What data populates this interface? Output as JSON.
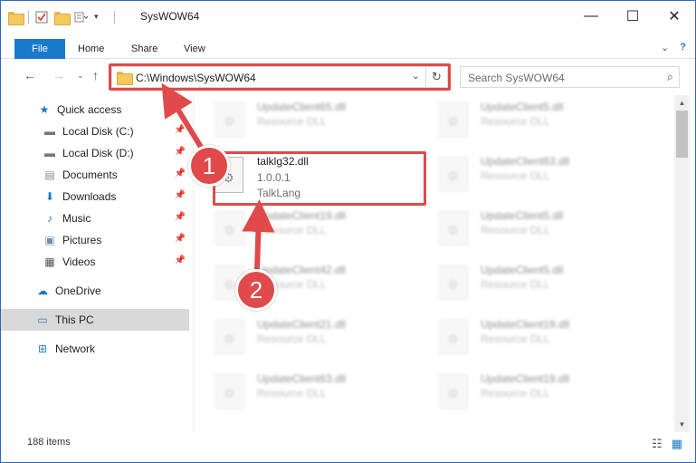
{
  "window": {
    "title": "SysWOW64"
  },
  "ribbon": {
    "tabs": [
      "File",
      "Home",
      "Share",
      "View"
    ]
  },
  "address": {
    "path": "C:\\Windows\\SysWOW64"
  },
  "search": {
    "placeholder": "Search SysWOW64"
  },
  "sidebar": {
    "items": [
      {
        "label": "Quick access",
        "icon": "star-icon",
        "pinned": false
      },
      {
        "label": "Local Disk (C:)",
        "icon": "drive-icon",
        "pinned": true
      },
      {
        "label": "Local Disk (D:)",
        "icon": "drive-icon",
        "pinned": true
      },
      {
        "label": "Documents",
        "icon": "documents-icon",
        "pinned": true
      },
      {
        "label": "Downloads",
        "icon": "download-icon",
        "pinned": true
      },
      {
        "label": "Music",
        "icon": "music-icon",
        "pinned": true
      },
      {
        "label": "Pictures",
        "icon": "pictures-icon",
        "pinned": true
      },
      {
        "label": "Videos",
        "icon": "videos-icon",
        "pinned": true
      },
      {
        "label": "OneDrive",
        "icon": "cloud-icon",
        "pinned": false
      },
      {
        "label": "This PC",
        "icon": "pc-icon",
        "pinned": false,
        "selected": true
      },
      {
        "label": "Network",
        "icon": "network-icon",
        "pinned": false
      }
    ]
  },
  "files": {
    "left": [
      {
        "name": "UpdateClient65.dll",
        "desc": "Resource DLL"
      },
      {
        "name": "UpdateClient19.dll",
        "desc": "Resource DLL"
      },
      {
        "name": "UpdateClient42.dll",
        "desc": "Resource DLL"
      },
      {
        "name": "UpdateClient21.dll",
        "desc": "Resource DLL"
      },
      {
        "name": "UpdateClient63.dll",
        "desc": "Resource DLL"
      }
    ],
    "right": [
      {
        "name": "UpdateClient5.dll",
        "desc": "Resource DLL"
      },
      {
        "name": "UpdateClient63.dll",
        "desc": "Resource DLL"
      },
      {
        "name": "UpdateClient5.dll",
        "desc": "Resource DLL"
      },
      {
        "name": "UpdateClient5.dll",
        "desc": "Resource DLL"
      },
      {
        "name": "UpdateClient19.dll",
        "desc": "Resource DLL"
      },
      {
        "name": "UpdateClient19.dll",
        "desc": "Resource DLL"
      }
    ],
    "highlighted": {
      "name": "talklg32.dll",
      "version": "1.0.0.1",
      "company": "TalkLang"
    }
  },
  "status": {
    "count": "188 items"
  },
  "annotations": {
    "badge1": "1",
    "badge2": "2",
    "color": "#e04a4a"
  }
}
